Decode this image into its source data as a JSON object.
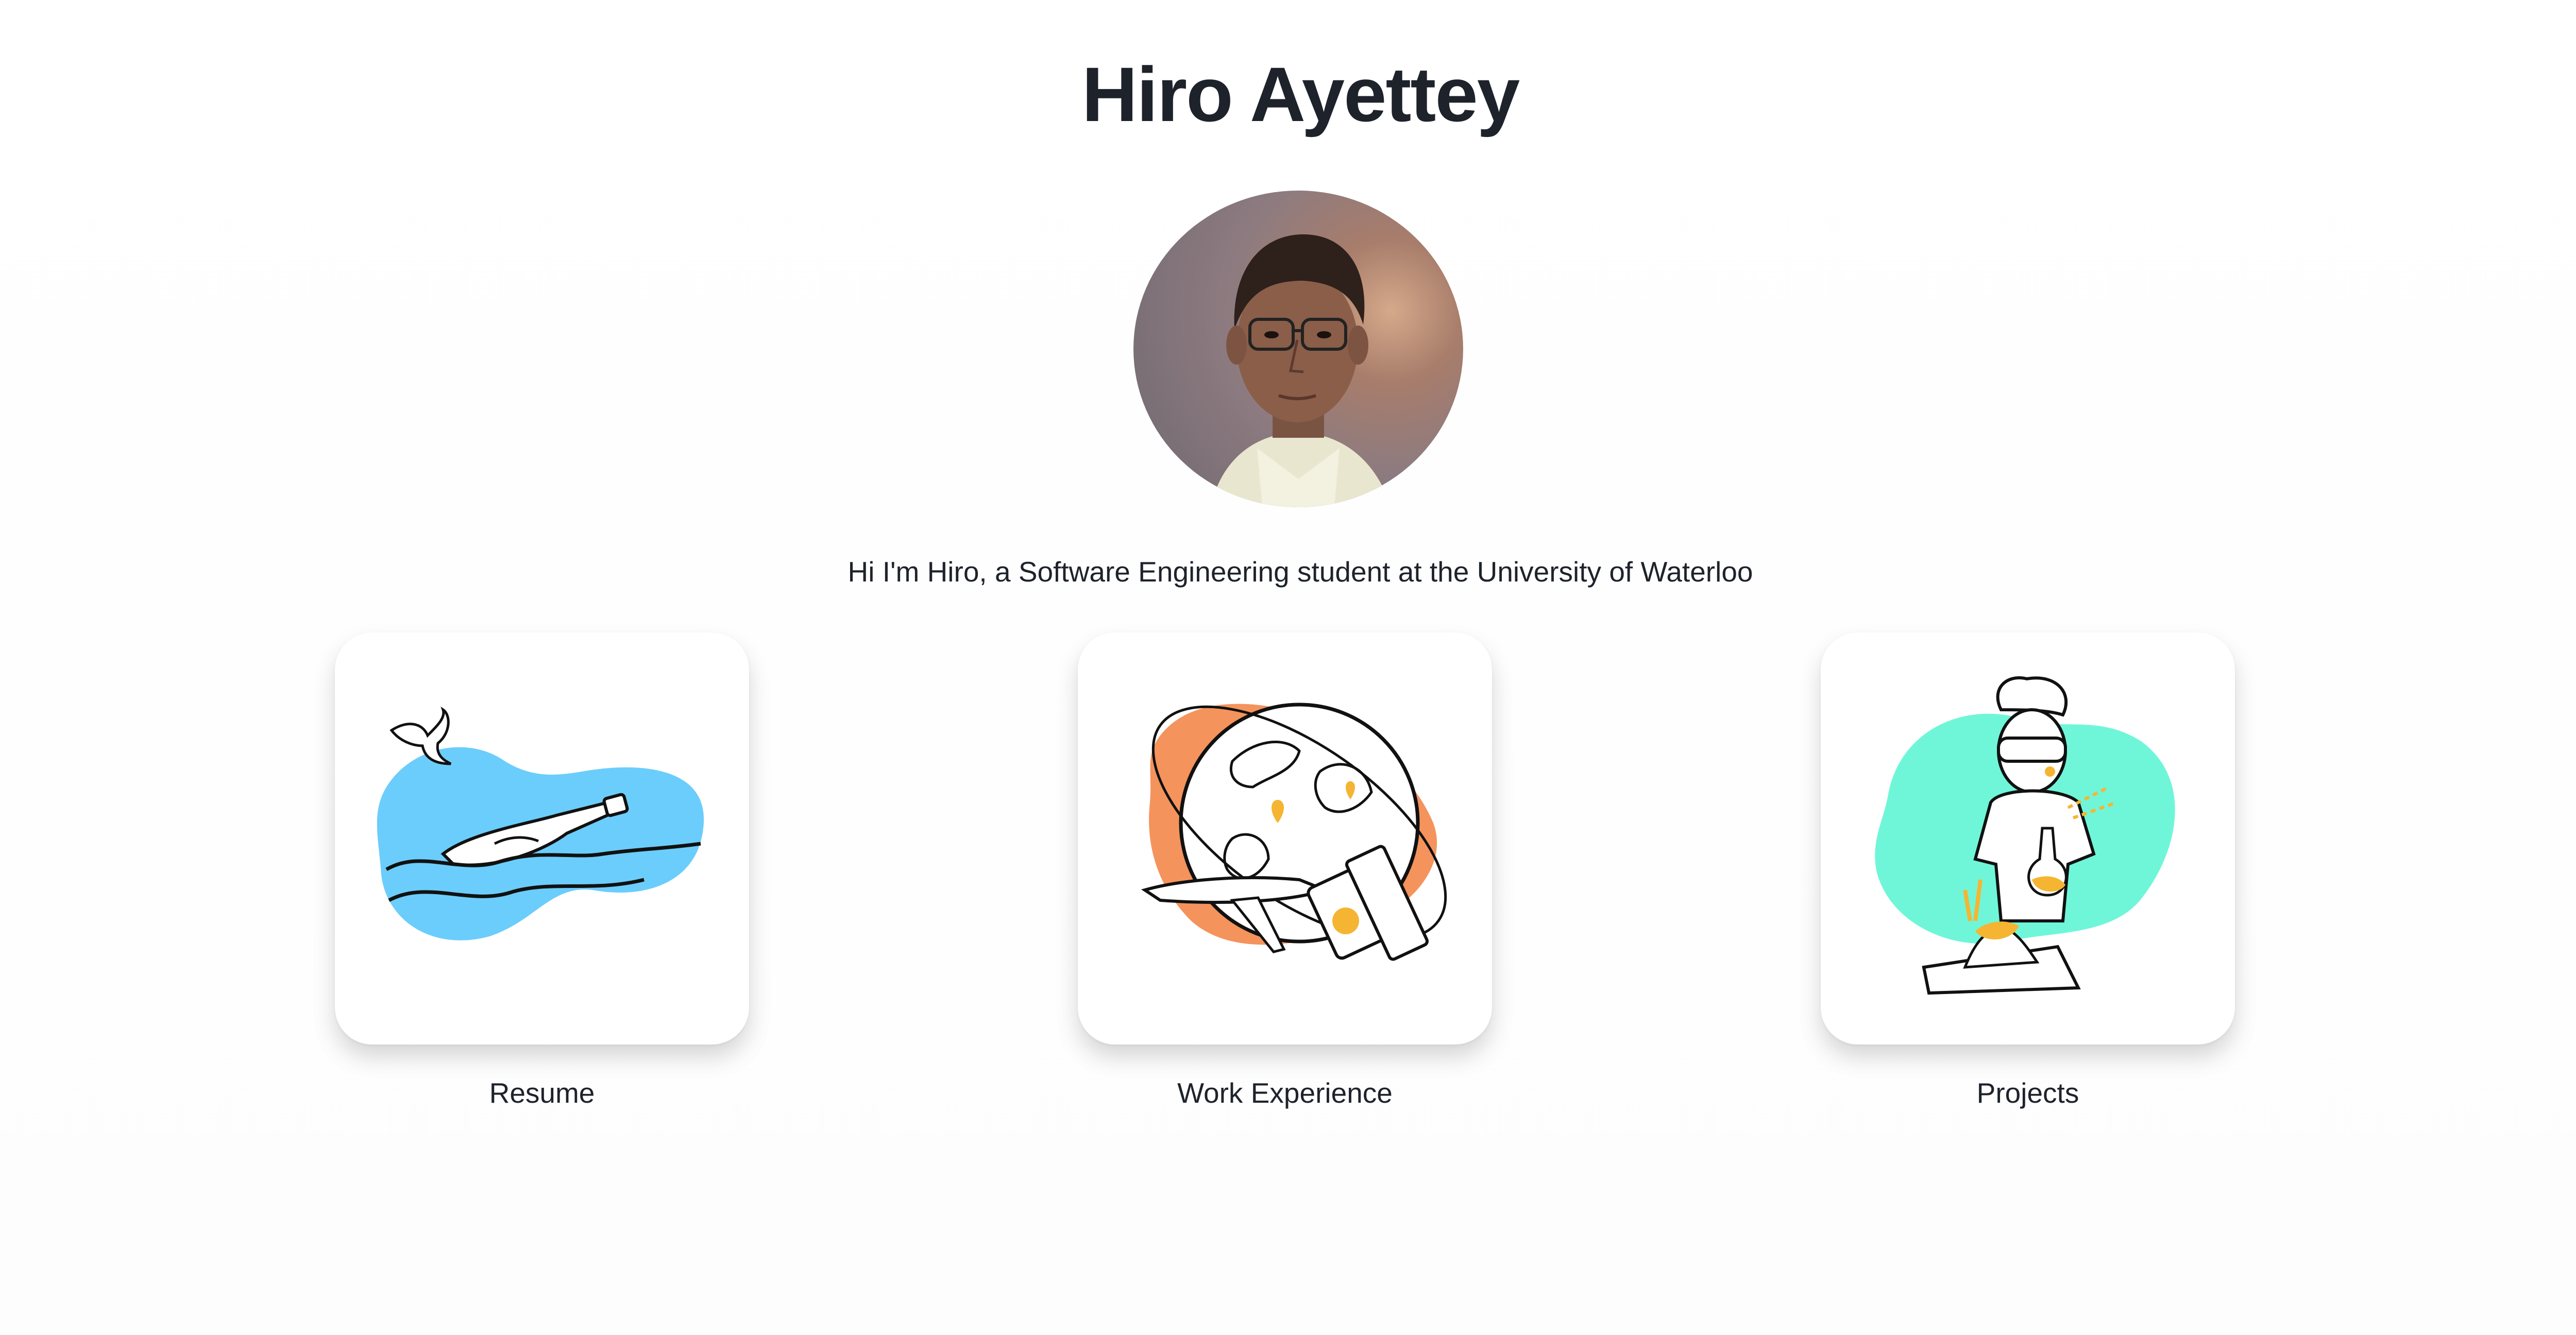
{
  "header": {
    "name": "Hiro Ayettey"
  },
  "profile": {
    "intro": "Hi I'm Hiro, a Software Engineering student at the University of Waterloo"
  },
  "cards": [
    {
      "label": "Resume",
      "icon": "message-in-bottle-icon",
      "color": "#6bcdfb"
    },
    {
      "label": "Work Experience",
      "icon": "globe-travel-icon",
      "color": "#f4935c"
    },
    {
      "label": "Projects",
      "icon": "scientist-icon",
      "color": "#6ff6d8"
    }
  ],
  "colors": {
    "text": "#1e222b",
    "accent_yellow": "#f5b532"
  }
}
